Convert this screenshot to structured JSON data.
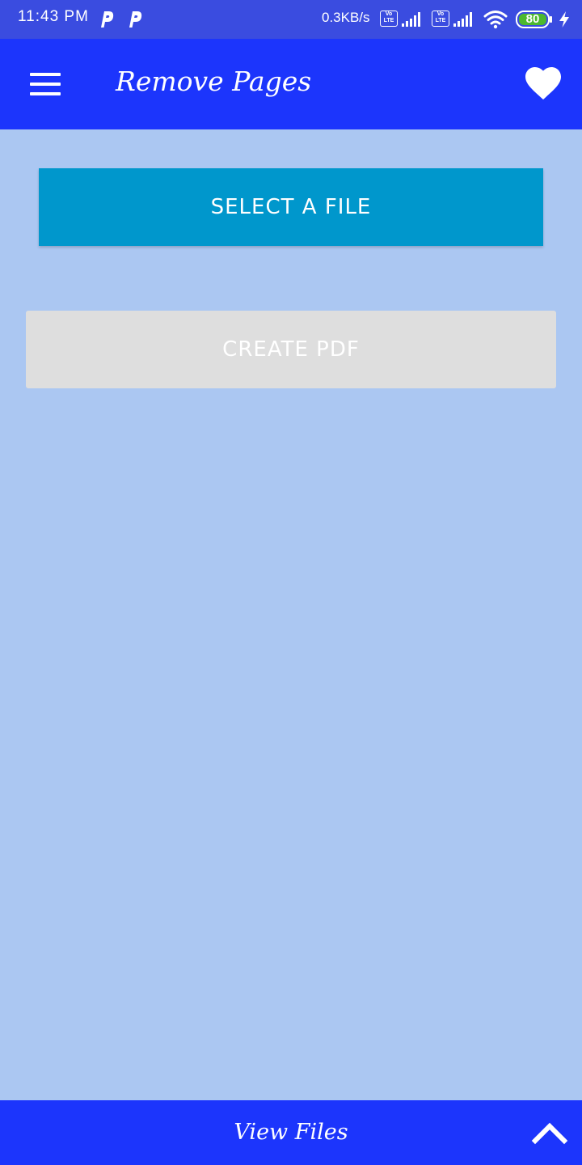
{
  "status_bar": {
    "time": "11:43 PM",
    "notif_icons": [
      "p-icon",
      "p-icon"
    ],
    "net_speed": "0.3KB/s",
    "volte_label": "Vo LTE",
    "battery": "80",
    "icons": [
      "volte-icon",
      "signal-icon",
      "volte-icon",
      "signal-icon",
      "wifi-icon",
      "battery-icon",
      "charging-bolt-icon"
    ]
  },
  "app_bar": {
    "title": "Remove Pages",
    "menu_icon": "hamburger-menu-icon",
    "favorite_icon": "heart-icon"
  },
  "main": {
    "select_file_label": "SELECT A FILE",
    "create_pdf_label": "CREATE PDF",
    "create_pdf_enabled": false
  },
  "bottom_bar": {
    "label": "View Files",
    "icon": "chevron-up-icon"
  },
  "colors": {
    "status_bar": "#3a4ce0",
    "app_bar": "#1c35fc",
    "background": "#abc7f2",
    "select_button": "#0097cc",
    "create_button_disabled": "#dedede",
    "battery_fill": "#4cb82e"
  }
}
